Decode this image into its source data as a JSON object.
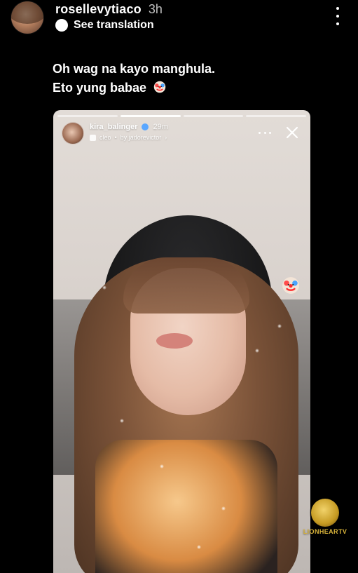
{
  "header": {
    "username": "rosellevytiaco",
    "time": "3h",
    "translation_label": "See translation"
  },
  "caption": {
    "line1": "Oh wag na kayo manghula.",
    "line2": "Eto yung babae"
  },
  "story": {
    "username": "kira_balinger",
    "time": "29m",
    "music_title": "cleo",
    "music_artist": "by jadorevictor",
    "progress_segments": 4,
    "active_segment": 2
  },
  "icons": {
    "clown": "clown-emoji",
    "translate": "translate-icon",
    "more": "more-icon",
    "close": "close-icon",
    "verified": "verified-icon",
    "music": "music-icon"
  },
  "watermark": {
    "brand": "LIONHEARTV"
  },
  "colors": {
    "background": "#000000",
    "text": "#ffffff",
    "muted": "#bfbfbf",
    "accent": "#5aa7ff"
  }
}
